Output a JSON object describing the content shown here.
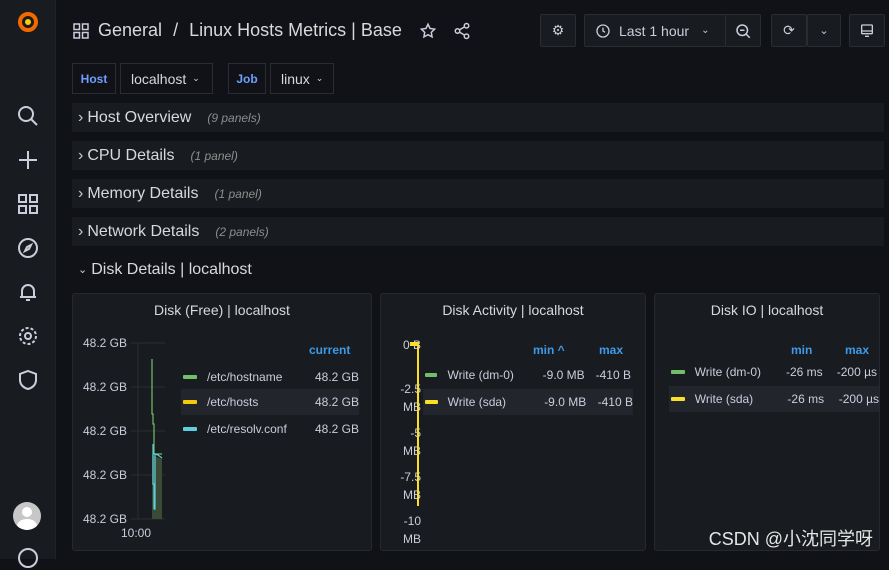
{
  "breadcrumb": {
    "folder": "General",
    "separator": "/",
    "dashboard": "Linux Hosts Metrics | Base"
  },
  "toolbar": {
    "time_range": "Last 1 hour"
  },
  "variables": [
    {
      "label": "Host",
      "value": "localhost"
    },
    {
      "label": "Job",
      "value": "linux"
    }
  ],
  "rows": [
    {
      "title": "Host Overview",
      "count": "(9 panels)",
      "collapsed": true
    },
    {
      "title": "CPU Details",
      "count": "(1 panel)",
      "collapsed": true
    },
    {
      "title": "Memory Details",
      "count": "(1 panel)",
      "collapsed": true
    },
    {
      "title": "Network Details",
      "count": "(2 panels)",
      "collapsed": true
    },
    {
      "title": "Disk Details | localhost",
      "count": "",
      "collapsed": false
    }
  ],
  "panels": {
    "disk_free": {
      "title": "Disk (Free) | localhost",
      "y_ticks": [
        "48.2 GB",
        "48.2 GB",
        "48.2 GB",
        "48.2 GB",
        "48.2 GB"
      ],
      "x_ticks": [
        "10:00"
      ],
      "legend_header": "current",
      "series": [
        {
          "name": "/etc/hostname",
          "current": "48.2 GB",
          "color": "#73bf69"
        },
        {
          "name": "/etc/hosts",
          "current": "48.2 GB",
          "color": "#f2cc0c"
        },
        {
          "name": "/etc/resolv.conf",
          "current": "48.2 GB",
          "color": "#5ed0dd"
        }
      ]
    },
    "disk_activity": {
      "title": "Disk Activity | localhost",
      "y_ticks": [
        "0 B",
        "-2.5 MB",
        "-5 MB",
        "-7.5 MB",
        "-10 MB"
      ],
      "headers": [
        "min ^",
        "max"
      ],
      "series": [
        {
          "name": "Write (dm-0)",
          "min": "-9.0 MB",
          "max": "-410 B",
          "color": "#73bf69"
        },
        {
          "name": "Write (sda)",
          "min": "-9.0 MB",
          "max": "-410 B",
          "color": "#fade2a"
        }
      ]
    },
    "disk_io": {
      "title": "Disk IO | localhost",
      "headers": [
        "min",
        "max"
      ],
      "series": [
        {
          "name": "Write (dm-0)",
          "min": "-26 ms",
          "max": "-200 µs",
          "color": "#73bf69"
        },
        {
          "name": "Write (sda)",
          "min": "-26 ms",
          "max": "-200 µs",
          "color": "#fade2a"
        }
      ]
    }
  },
  "watermark": "CSDN @小沈同学呀"
}
